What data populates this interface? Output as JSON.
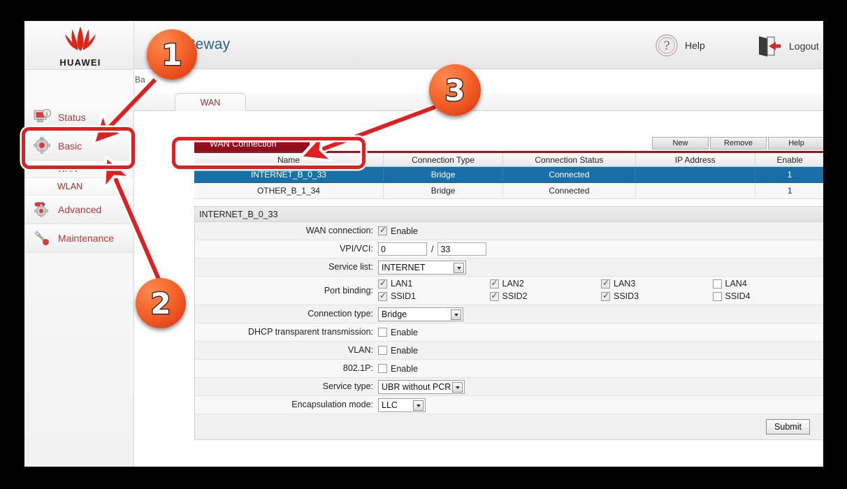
{
  "app": {
    "brand": "HUAWEI",
    "title": "Gateway",
    "title_full_visible": "Gateway"
  },
  "topbar": {
    "help_label": "Help",
    "help_icon": "question-circle-icon",
    "logout_label": "Logout",
    "logout_icon": "logout-door-icon"
  },
  "breadcrumb": "Ba",
  "tabs": [
    {
      "label": "WAN",
      "active": true
    }
  ],
  "sidebar": {
    "items": [
      {
        "label": "Status",
        "icon": "monitor-info-icon",
        "sub": []
      },
      {
        "label": "Basic",
        "icon": "gear-icon",
        "sub": [
          {
            "label": "WAN"
          },
          {
            "label": "WLAN"
          }
        ]
      },
      {
        "label": "Advanced",
        "icon": "gear-tools-icon",
        "sub": []
      },
      {
        "label": "Maintenance",
        "icon": "wrench-icon",
        "sub": []
      }
    ]
  },
  "panel": {
    "title": "WAN Connection",
    "buttons": [
      {
        "label": "New"
      },
      {
        "label": "Remove"
      },
      {
        "label": "Help"
      }
    ],
    "table": {
      "columns": [
        "Name",
        "Connection Type",
        "Connection Status",
        "IP Address",
        "Enable"
      ],
      "rows": [
        {
          "name": "INTERNET_B_0_33",
          "connection_type": "Bridge",
          "connection_status": "Connected",
          "ip_address": "",
          "enable": "1",
          "selected": true
        },
        {
          "name": "OTHER_B_1_34",
          "connection_type": "Bridge",
          "connection_status": "Connected",
          "ip_address": "",
          "enable": "1",
          "selected": false
        }
      ]
    }
  },
  "form": {
    "title": "INTERNET_B_0_33",
    "wan_connection_label": "WAN connection:",
    "wan_connection_enable_label": "Enable",
    "wan_connection_checked": true,
    "vpivci_label": "VPI/VCI:",
    "vpi_value": "0",
    "vci_value": "33",
    "vpivci_separator": "/",
    "service_list_label": "Service list:",
    "service_list_value": "INTERNET",
    "port_binding_label": "Port binding:",
    "port_binding": [
      {
        "label": "LAN1",
        "checked": true
      },
      {
        "label": "LAN2",
        "checked": true
      },
      {
        "label": "LAN3",
        "checked": true
      },
      {
        "label": "LAN4",
        "checked": false
      },
      {
        "label": "SSID1",
        "checked": true
      },
      {
        "label": "SSID2",
        "checked": true
      },
      {
        "label": "SSID3",
        "checked": true
      },
      {
        "label": "SSID4",
        "checked": false
      }
    ],
    "connection_type_label": "Connection type:",
    "connection_type_value": "Bridge",
    "dhcp_label": "DHCP transparent transmission:",
    "dhcp_enable_label": "Enable",
    "dhcp_checked": false,
    "vlan_label": "VLAN:",
    "vlan_enable_label": "Enable",
    "vlan_checked": false,
    "dot1p_label": "802.1P:",
    "dot1p_enable_label": "Enable",
    "dot1p_checked": false,
    "service_type_label": "Service type:",
    "service_type_value": "UBR without PCR",
    "encapsulation_label": "Encapsulation mode:",
    "encapsulation_value": "LLC",
    "submit_label": "Submit"
  },
  "annotations": {
    "badges": [
      {
        "number": "1"
      },
      {
        "number": "2"
      },
      {
        "number": "3"
      }
    ]
  },
  "colors": {
    "brand_red": "#e2231a",
    "panel_red": "#9b1420",
    "selected_row_blue": "#1a6fa8",
    "title_blue": "#2c5e8f",
    "annotation_orange": "#f4672c",
    "highlight_red": "#e02020"
  }
}
